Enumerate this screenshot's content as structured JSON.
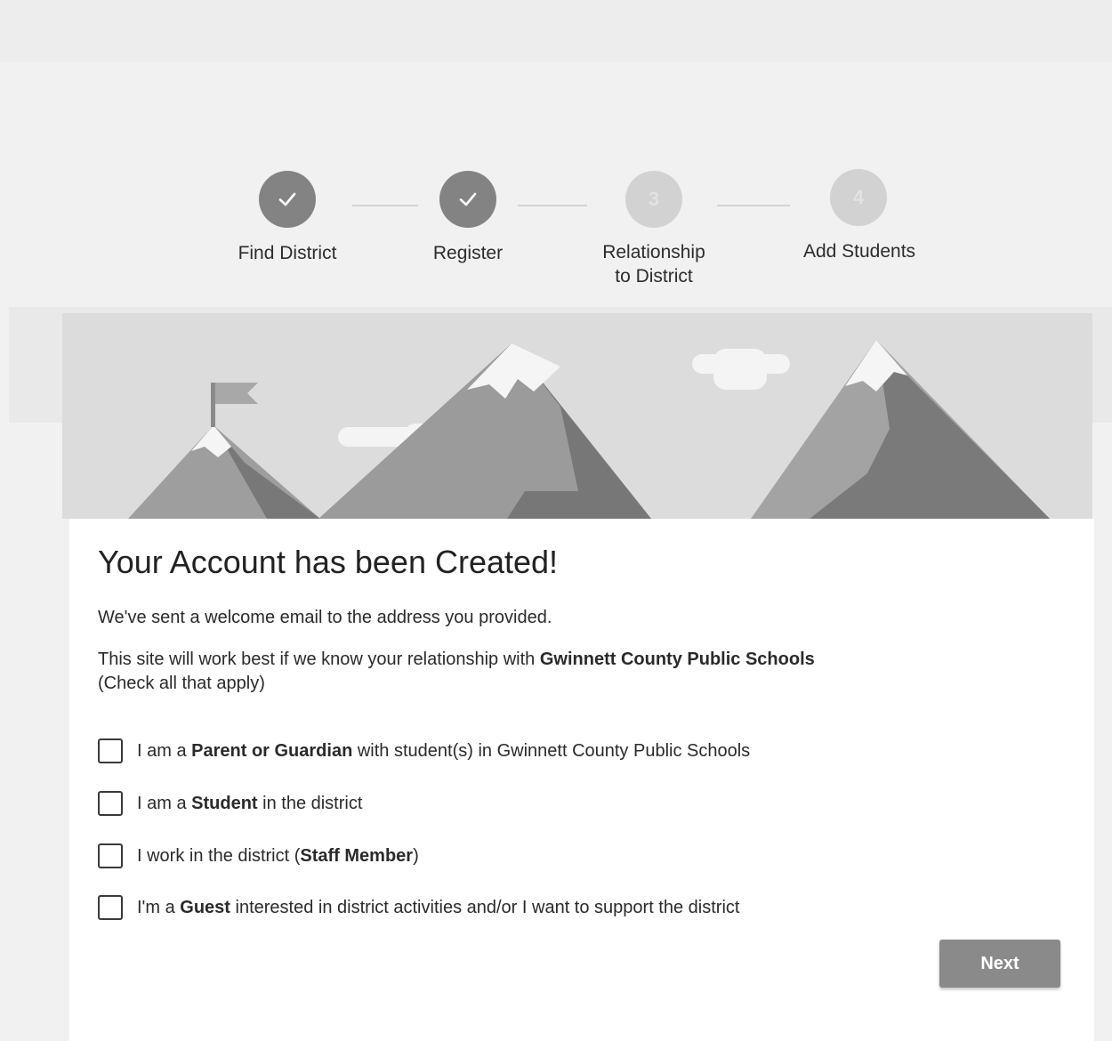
{
  "stepper": {
    "steps": [
      {
        "label": "Find District",
        "status": "complete",
        "icon": "check-icon"
      },
      {
        "label": "Register",
        "status": "complete",
        "icon": "check-icon"
      },
      {
        "label": "Relationship\nto District",
        "status": "pending",
        "number": "3"
      },
      {
        "label": "Add Students",
        "status": "pending",
        "number": "4"
      }
    ]
  },
  "banner": {
    "icon": "mountains-illustration"
  },
  "card": {
    "title": "Your Account has been Created!",
    "welcome_text": "We've sent a welcome email to the address you provided.",
    "relationship_prefix": "This site will work best if we know your relationship with ",
    "district_name": "Gwinnett County Public Schools",
    "check_all": "(Check all that apply)",
    "options": [
      {
        "prefix": "I am a ",
        "bold": "Parent or Guardian",
        "suffix": " with student(s) in Gwinnett County Public Schools",
        "checked": false
      },
      {
        "prefix": "I am a ",
        "bold": "Student",
        "suffix": " in the district",
        "checked": false
      },
      {
        "prefix": "I work in the district (",
        "bold": "Staff Member",
        "suffix": ")",
        "checked": false
      },
      {
        "prefix": "I'm a ",
        "bold": "Guest",
        "suffix": " interested in district activities and/or I want to support the district",
        "checked": false
      }
    ],
    "next_label": "Next"
  },
  "colors": {
    "step_complete": "#838383",
    "step_pending": "#d2d2d2",
    "button": "#8a8a8a"
  }
}
